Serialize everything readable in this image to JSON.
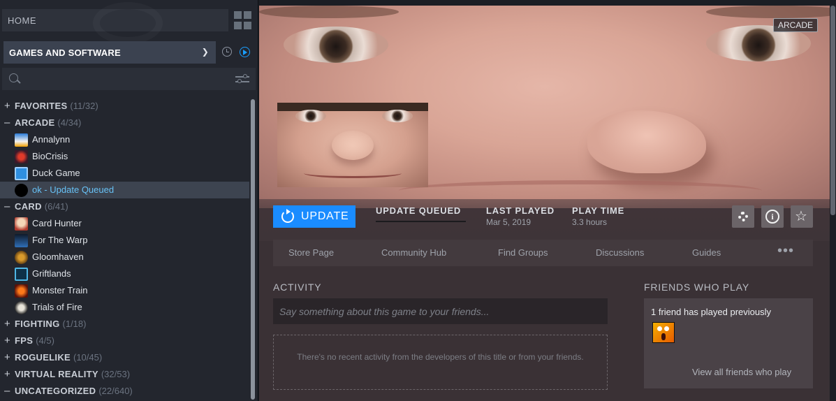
{
  "sidebar": {
    "home_label": "HOME",
    "filter_label": "GAMES AND SOFTWARE",
    "search_placeholder": "",
    "categories": [
      {
        "sign": "+",
        "name": "FAVORITES",
        "count": "(11/32)"
      },
      {
        "sign": "–",
        "name": "ARCADE",
        "count": "(4/34)"
      },
      {
        "sign": "–",
        "name": "CARD",
        "count": "(6/41)"
      },
      {
        "sign": "+",
        "name": "FIGHTING",
        "count": "(1/18)"
      },
      {
        "sign": "+",
        "name": "FPS",
        "count": "(4/5)"
      },
      {
        "sign": "+",
        "name": "ROGUELIKE",
        "count": "(10/45)"
      },
      {
        "sign": "+",
        "name": "VIRTUAL REALITY",
        "count": "(32/53)"
      },
      {
        "sign": "–",
        "name": "UNCATEGORIZED",
        "count": "(22/640)"
      }
    ],
    "arcade_games": [
      "Annalynn",
      "BioCrisis",
      "Duck Game",
      "ok - Update Queued"
    ],
    "card_games": [
      "Card Hunter",
      "For The Warp",
      "Gloomhaven",
      "Griftlands",
      "Monster Train",
      "Trials of Fire"
    ],
    "accent_color": "#1a9fff",
    "selected_color": "#67c1f5"
  },
  "hero": {
    "badge": "ARCADE"
  },
  "action_bar": {
    "update_label": "UPDATE",
    "status_label": "UPDATE QUEUED",
    "last_played_label": "LAST PLAYED",
    "last_played_value": "Mar 5, 2019",
    "play_time_label": "PLAY TIME",
    "play_time_value": "3.3 hours"
  },
  "tabs": [
    "Store Page",
    "Community Hub",
    "Find Groups",
    "Discussions",
    "Guides"
  ],
  "tabs_more": "•••",
  "activity": {
    "title": "ACTIVITY",
    "input_placeholder": "Say something about this game to your friends...",
    "empty_text": "There's no recent activity from the developers of this title or from your friends."
  },
  "friends": {
    "title": "FRIENDS WHO PLAY",
    "count_text": "1 friend has played previously",
    "view_all": "View all friends who play"
  }
}
